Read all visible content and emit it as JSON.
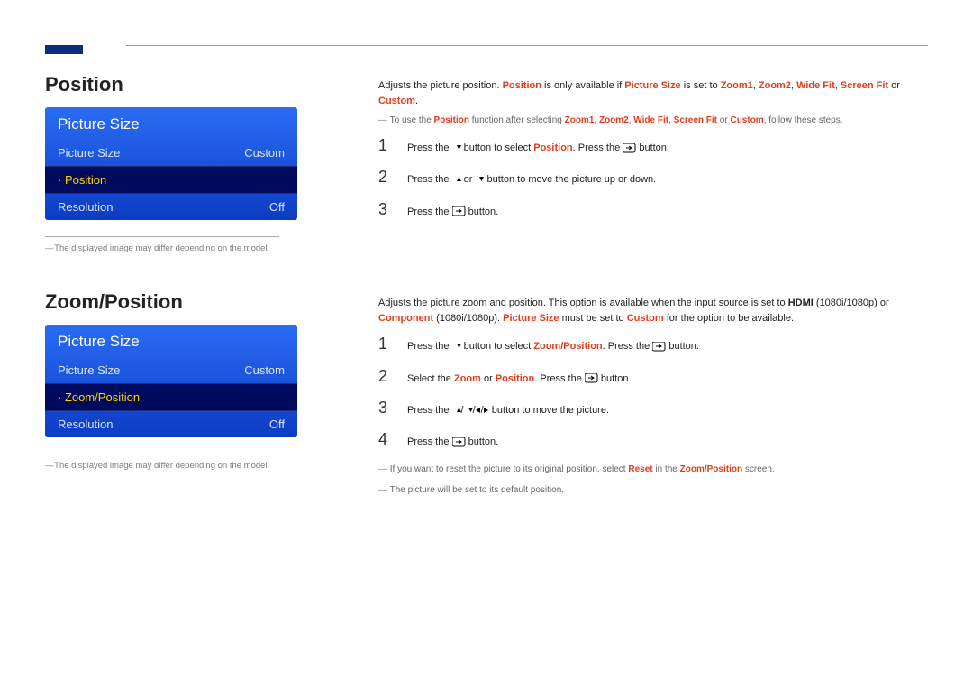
{
  "sections": {
    "position": {
      "heading": "Position",
      "menu": {
        "title": "Picture Size",
        "rows": [
          {
            "label": "Picture Size",
            "value": "Custom",
            "selected": false
          },
          {
            "label": "Position",
            "value": "",
            "selected": true
          },
          {
            "label": "Resolution",
            "value": "Off",
            "selected": false
          }
        ]
      },
      "image_note": "The displayed image may differ depending on the model.",
      "intro": {
        "pre": "Adjusts the picture position. ",
        "hl1": "Position",
        "mid1": " is only available if ",
        "hl2": "Picture Size",
        "mid2": " is set to ",
        "hl3": "Zoom1",
        "sep1": ", ",
        "hl4": "Zoom2",
        "sep2": ", ",
        "hl5": "Wide Fit",
        "sep3": ", ",
        "hl6": "Screen Fit",
        "mid3": " or ",
        "hl7": "Custom",
        "end": "."
      },
      "intro_note": {
        "pre": "To use the ",
        "hl1": "Position",
        "mid1": " function after selecting ",
        "hl2": "Zoom1",
        "sep1": ", ",
        "hl3": "Zoom2",
        "sep2": ", ",
        "hl4": "Wide Fit",
        "sep3": ", ",
        "hl5": "Screen Fit",
        "mid2": " or ",
        "hl6": "Custom",
        "end": ", follow these steps."
      },
      "steps": [
        {
          "num": "1",
          "pre": "Press the ",
          "icon1": "down",
          "mid1": " button to select ",
          "hl1": "Position",
          "mid2": ". Press the ",
          "icon2": "enter",
          "end": " button."
        },
        {
          "num": "2",
          "pre": "Press the ",
          "icon1": "up",
          "mid1": " or ",
          "icon2": "down",
          "end": " button to move the picture up or down."
        },
        {
          "num": "3",
          "pre": "Press the ",
          "icon1": "enter",
          "end": " button."
        }
      ]
    },
    "zoom": {
      "heading": "Zoom/Position",
      "menu": {
        "title": "Picture Size",
        "rows": [
          {
            "label": "Picture Size",
            "value": "Custom",
            "selected": false
          },
          {
            "label": "Zoom/Position",
            "value": "",
            "selected": true
          },
          {
            "label": "Resolution",
            "value": "Off",
            "selected": false
          }
        ]
      },
      "image_note": "The displayed image may differ depending on the model.",
      "intro": {
        "pre": "Adjusts the picture zoom and position. This option is available when the input source is set to ",
        "bl1": "HDMI",
        "mid1": " (1080i/1080p) or ",
        "hl1": "Component",
        "mid2": " (1080i/1080p). ",
        "hl2": "Picture Size",
        "mid3": " must be set to ",
        "hl3": "Custom",
        "end": " for the option to be available."
      },
      "steps": [
        {
          "num": "1",
          "pre": "Press the ",
          "icon1": "down",
          "mid1": " button to select ",
          "hl1": "Zoom/Position",
          "mid2": ". Press the ",
          "icon2": "enter",
          "end": " button."
        },
        {
          "num": "2",
          "pre": "Select the ",
          "hl1": "Zoom",
          "mid1": " or ",
          "hl2": "Position",
          "mid2": ". Press the ",
          "icon1": "enter",
          "end": " button."
        },
        {
          "num": "3",
          "pre": "Press the ",
          "icon1": "updown-leftright",
          "end": " button to move the picture."
        },
        {
          "num": "4",
          "pre": "Press the ",
          "icon1": "enter",
          "end": " button."
        }
      ],
      "end_notes": [
        {
          "pre": "If you want to reset the picture to its original position, select ",
          "hl1": "Reset",
          "mid1": " in the ",
          "hl2": "Zoom/Position",
          "end": " screen."
        },
        {
          "pre": "The picture will be set to its default position."
        }
      ]
    }
  }
}
